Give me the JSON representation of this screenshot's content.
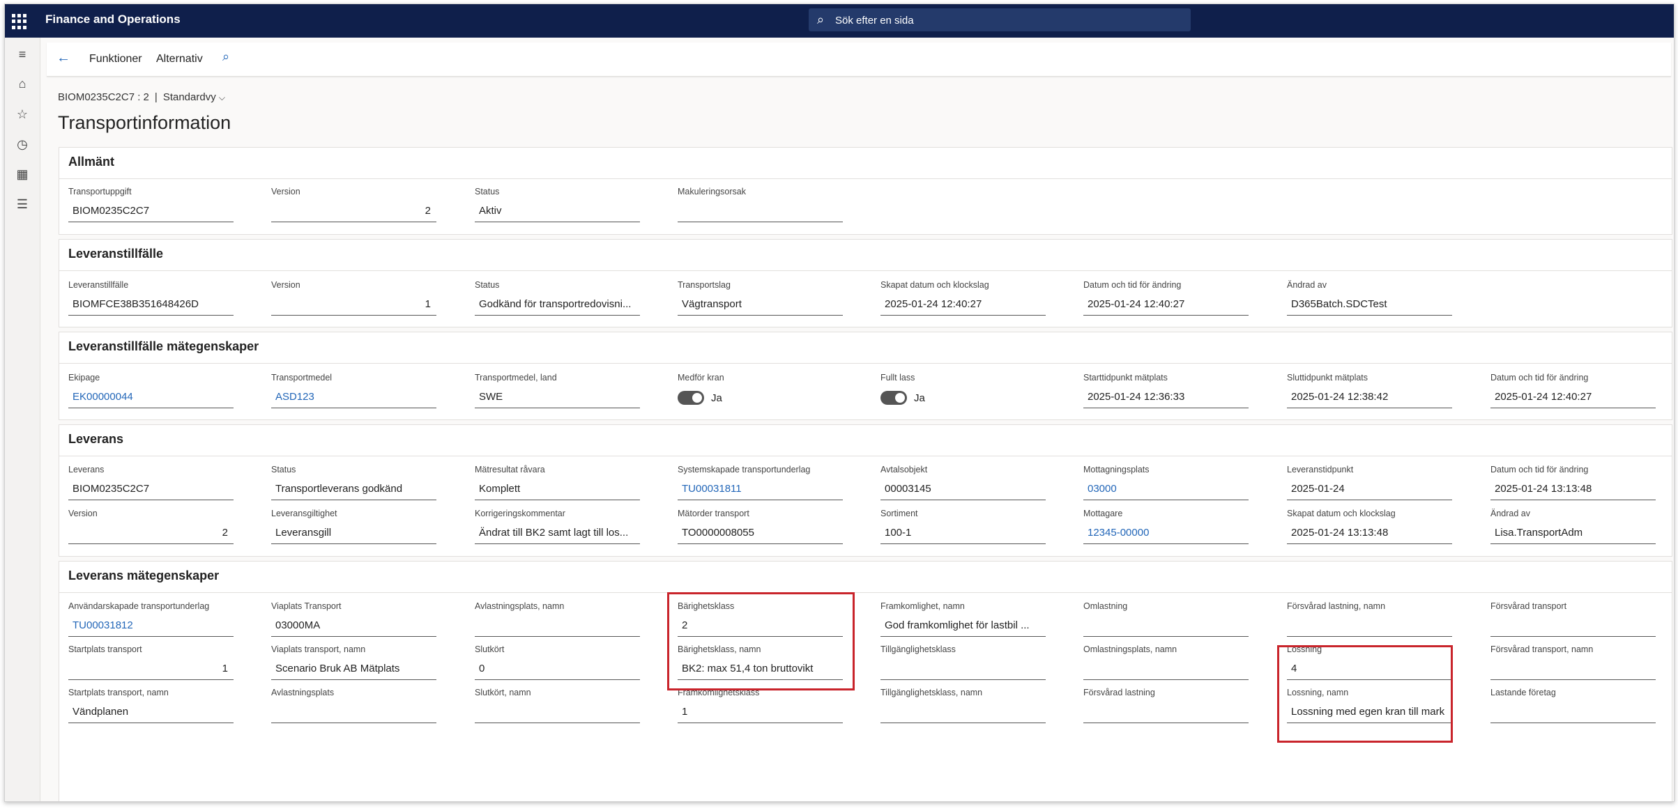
{
  "app": {
    "title": "Finance and Operations",
    "search_placeholder": "Sök efter en sida"
  },
  "actionbar": {
    "funktioner": "Funktioner",
    "alternativ": "Alternativ"
  },
  "breadcrumb": {
    "record": "BIOM0235C2C7 : 2",
    "separator": "|",
    "view": "Standardvy"
  },
  "page_title": "Transportinformation",
  "allmant": {
    "header": "Allmänt",
    "fields": [
      {
        "label": "Transportuppgift",
        "value": "BIOM0235C2C7"
      },
      {
        "label": "Version",
        "value": "2"
      },
      {
        "label": "Status",
        "value": "Aktiv"
      },
      {
        "label": "Makuleringsorsak",
        "value": ""
      }
    ]
  },
  "leveranstillfalle": {
    "header": "Leveranstillfälle",
    "fields": [
      {
        "label": "Leveranstillfälle",
        "value": "BIOMFCE38B351648426D"
      },
      {
        "label": "Version",
        "value": "1"
      },
      {
        "label": "Status",
        "value": "Godkänd för transportredovisni..."
      },
      {
        "label": "Transportslag",
        "value": "Vägtransport"
      },
      {
        "label": "Skapat datum och klockslag",
        "value": "2025-01-24 12:40:27"
      },
      {
        "label": "Datum och tid för ändring",
        "value": "2025-01-24 12:40:27"
      },
      {
        "label": "Ändrad av",
        "value": "D365Batch.SDCTest"
      }
    ]
  },
  "mategenskaper": {
    "header": "Leveranstillfälle mätegenskaper",
    "fields": [
      {
        "label": "Ekipage",
        "value": "EK00000044"
      },
      {
        "label": "Transportmedel",
        "value": "ASD123"
      },
      {
        "label": "Transportmedel, land",
        "value": "SWE"
      },
      {
        "label": "Medför kran",
        "value": "Ja"
      },
      {
        "label": "Fullt lass",
        "value": "Ja"
      },
      {
        "label": "Starttidpunkt mätplats",
        "value": "2025-01-24 12:36:33"
      },
      {
        "label": "Sluttidpunkt mätplats",
        "value": "2025-01-24 12:38:42"
      },
      {
        "label": "Datum och tid för ändring",
        "value": "2025-01-24 12:40:27"
      }
    ]
  },
  "leverans": {
    "header": "Leverans",
    "row1": [
      {
        "label": "Leverans",
        "value": "BIOM0235C2C7"
      },
      {
        "label": "Status",
        "value": "Transportleverans godkänd"
      },
      {
        "label": "Mätresultat råvara",
        "value": "Komplett"
      },
      {
        "label": "Systemskapade transportunderlag",
        "value": "TU00031811"
      },
      {
        "label": "Avtalsobjekt",
        "value": "00003145"
      },
      {
        "label": "Mottagningsplats",
        "value": "03000"
      },
      {
        "label": "Leveranstidpunkt",
        "value": "2025-01-24"
      },
      {
        "label": "Datum och tid för ändring",
        "value": "2025-01-24 13:13:48"
      }
    ],
    "row2": [
      {
        "label": "Version",
        "value": "2"
      },
      {
        "label": "Leveransgiltighet",
        "value": "Leveransgill"
      },
      {
        "label": "Korrigeringskommentar",
        "value": "Ändrat till  BK2 samt lagt till los..."
      },
      {
        "label": "Mätorder transport",
        "value": "TO0000008055"
      },
      {
        "label": "Sortiment",
        "value": "100-1"
      },
      {
        "label": "Mottagare",
        "value": "12345-00000"
      },
      {
        "label": "Skapat datum och klockslag",
        "value": "2025-01-24 13:13:48"
      },
      {
        "label": "Ändrad av",
        "value": "Lisa.TransportAdm"
      }
    ]
  },
  "leverans_mat": {
    "header": "Leverans mätegenskaper",
    "row1": [
      {
        "label": "Användarskapade transportunderlag",
        "value": "TU00031812"
      },
      {
        "label": "Viaplats Transport",
        "value": "03000MA"
      },
      {
        "label": "Avlastningsplats, namn",
        "value": ""
      },
      {
        "label": "Bärighetsklass",
        "value": "2"
      },
      {
        "label": "Framkomlighet, namn",
        "value": "God framkomlighet för lastbil ..."
      },
      {
        "label": "Omlastning",
        "value": ""
      },
      {
        "label": "Försvårad lastning, namn",
        "value": ""
      },
      {
        "label": "Försvårad transport",
        "value": ""
      }
    ],
    "row2": [
      {
        "label": "Startplats transport",
        "value": "1"
      },
      {
        "label": "Viaplats transport, namn",
        "value": "Scenario Bruk AB Mätplats"
      },
      {
        "label": "Slutkört",
        "value": "0"
      },
      {
        "label": "Bärighetsklass, namn",
        "value": "BK2: max 51,4 ton bruttovikt"
      },
      {
        "label": "Tillgänglighetsklass",
        "value": ""
      },
      {
        "label": "Omlastningsplats, namn",
        "value": ""
      },
      {
        "label": "Lossning",
        "value": "4"
      },
      {
        "label": "Försvårad transport, namn",
        "value": ""
      }
    ],
    "row3": [
      {
        "label": "Startplats transport, namn",
        "value": "Vändplanen"
      },
      {
        "label": "Avlastningsplats",
        "value": ""
      },
      {
        "label": "Slutkört, namn",
        "value": ""
      },
      {
        "label": "Framkomlighetsklass",
        "value": "1"
      },
      {
        "label": "Tillgänglighetsklass, namn",
        "value": ""
      },
      {
        "label": "Försvårad lastning",
        "value": ""
      },
      {
        "label": "Lossning, namn",
        "value": "Lossning med egen kran till mark"
      },
      {
        "label": "Lastande företag",
        "value": ""
      }
    ]
  },
  "colors": {
    "topbar": "#0f1f4b",
    "link": "#2266b8",
    "highlight": "#c9242b"
  }
}
